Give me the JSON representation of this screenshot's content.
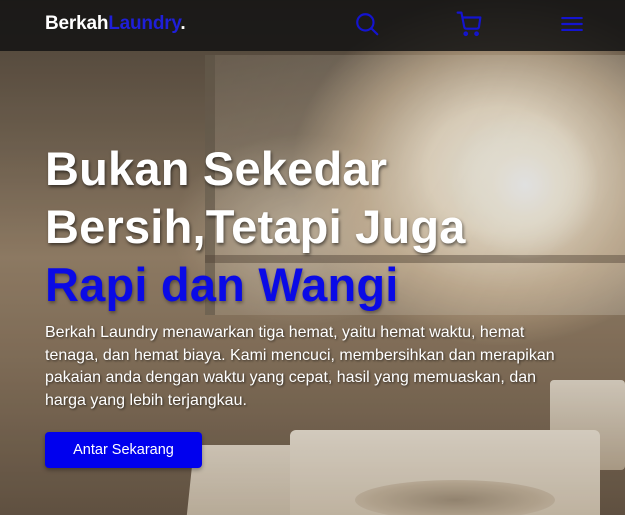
{
  "navbar": {
    "brand_primary": "Berkah",
    "brand_accent": "Laundry",
    "brand_dot": ".",
    "icons": [
      "search-icon",
      "cart-icon",
      "menu-icon"
    ]
  },
  "hero": {
    "headline_line1": "Bukan Sekedar",
    "headline_line2": "Bersih,Tetapi Juga",
    "headline_highlight": "Rapi dan Wangi",
    "description": "Berkah Laundry menawarkan tiga hemat, yaitu hemat waktu, hemat tenaga, dan hemat biaya. Kami mencuci, membersihkan dan merapikan pakaian anda dengan waktu yang cepat, hasil yang memuaskan, dan harga yang lebih terjangkau.",
    "cta_label": "Antar Sekarang"
  },
  "colors": {
    "accent": "#0000ee",
    "brand_accent": "#1f1fd8",
    "navbar_bg": "#141414",
    "text": "#ffffff"
  }
}
